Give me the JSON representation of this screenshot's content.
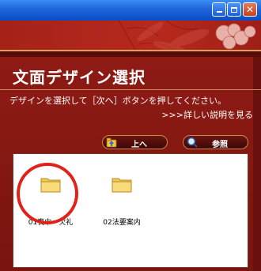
{
  "window": {
    "buttons": [
      "minimize",
      "maximize",
      "close"
    ]
  },
  "page": {
    "title": "文面デザイン選択",
    "instruction": "デザインを選択して［次へ］ボタンを押してください。",
    "help_link": ">>>詳しい説明を見る"
  },
  "toolbar": {
    "up_label": "上へ",
    "up_icon": "up-folder-icon",
    "search_label": "参照",
    "search_icon": "magnifier-icon"
  },
  "files": [
    {
      "name": "01喪中・欠礼",
      "icon": "folder-icon",
      "selected": true
    },
    {
      "name": "02法要案内",
      "icon": "folder-icon",
      "selected": false
    }
  ],
  "colors": {
    "banner": "#a52219",
    "panel": "#8e1b14",
    "highlight_circle": "#e0231a",
    "button_border": "#c68a4a"
  }
}
